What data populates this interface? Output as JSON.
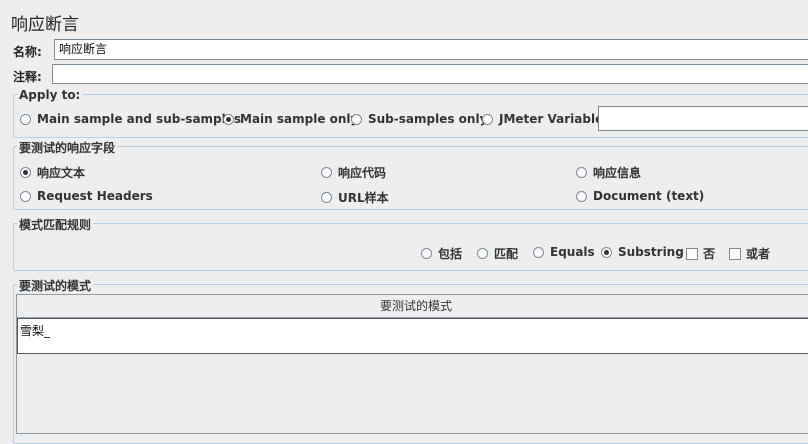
{
  "header": {
    "title": "响应断言"
  },
  "fields": {
    "name_label": "名称:",
    "name_value": "响应断言",
    "comment_label": "注释:",
    "comment_value": ""
  },
  "apply_to": {
    "title": "Apply to:",
    "options": [
      {
        "label": "Main sample and sub-samples",
        "selected": false
      },
      {
        "label": "Main sample only",
        "selected": true
      },
      {
        "label": "Sub-samples only",
        "selected": false
      },
      {
        "label": "JMeter Variable",
        "selected": false
      }
    ],
    "variable_value": ""
  },
  "response_field": {
    "title": "要测试的响应字段",
    "options": [
      {
        "label": "响应文本",
        "selected": true
      },
      {
        "label": "响应代码",
        "selected": false
      },
      {
        "label": "响应信息",
        "selected": false
      },
      {
        "label": "Request Headers",
        "selected": false
      },
      {
        "label": "URL样本",
        "selected": false
      },
      {
        "label": "Document (text)",
        "selected": false
      }
    ]
  },
  "pattern_rules": {
    "title": "模式匹配规则",
    "options": [
      {
        "label": "包括",
        "selected": false
      },
      {
        "label": "匹配",
        "selected": false
      },
      {
        "label": "Equals",
        "selected": false
      },
      {
        "label": "Substring",
        "selected": true
      }
    ],
    "checks": [
      {
        "label": "否",
        "checked": false
      },
      {
        "label": "或者",
        "checked": false
      }
    ]
  },
  "patterns": {
    "title": "要测试的模式",
    "column_header": "要测试的模式",
    "rows": [
      "雪梨_"
    ]
  }
}
